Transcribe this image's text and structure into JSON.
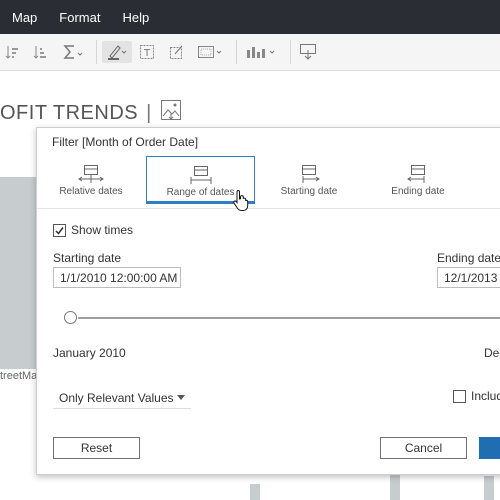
{
  "menu": {
    "items": [
      "Map",
      "Format",
      "Help"
    ]
  },
  "toolbar": {
    "icons": [
      "sort-ascending-icon",
      "sort-descending-icon",
      "sum-icon",
      "highlight-pen-icon",
      "text-box-icon",
      "annotate-icon",
      "fit-view-icon",
      "show-me-icon",
      "present-icon"
    ]
  },
  "worksheet": {
    "title": "OFIT TRENDS",
    "separator": "|",
    "row_label": "treetMa"
  },
  "dialog": {
    "title": "Filter [Month of Order Date]",
    "tabs": [
      {
        "label": "Relative dates",
        "selected": false
      },
      {
        "label": "Range of dates",
        "selected": true
      },
      {
        "label": "Starting date",
        "selected": false
      },
      {
        "label": "Ending date",
        "selected": false
      }
    ],
    "show_times": {
      "label": "Show times",
      "checked": true
    },
    "starting_date": {
      "label": "Starting date",
      "value": "1/1/2010 12:00:00 AM"
    },
    "ending_date": {
      "label": "Ending date",
      "value": "12/1/2013"
    },
    "range_start_label": "January 2010",
    "range_end_label": "Dec",
    "values_dropdown": {
      "selected": "Only Relevant Values"
    },
    "include_checkbox": {
      "label": "Includ",
      "checked": false
    },
    "buttons": {
      "reset": "Reset",
      "cancel": "Cancel",
      "ok": ""
    }
  },
  "colors": {
    "accent": "#2f7ec7",
    "primary_button": "#1f6eb4",
    "menubar": "#2a2d34",
    "bar_gray": "#c7ccce"
  }
}
